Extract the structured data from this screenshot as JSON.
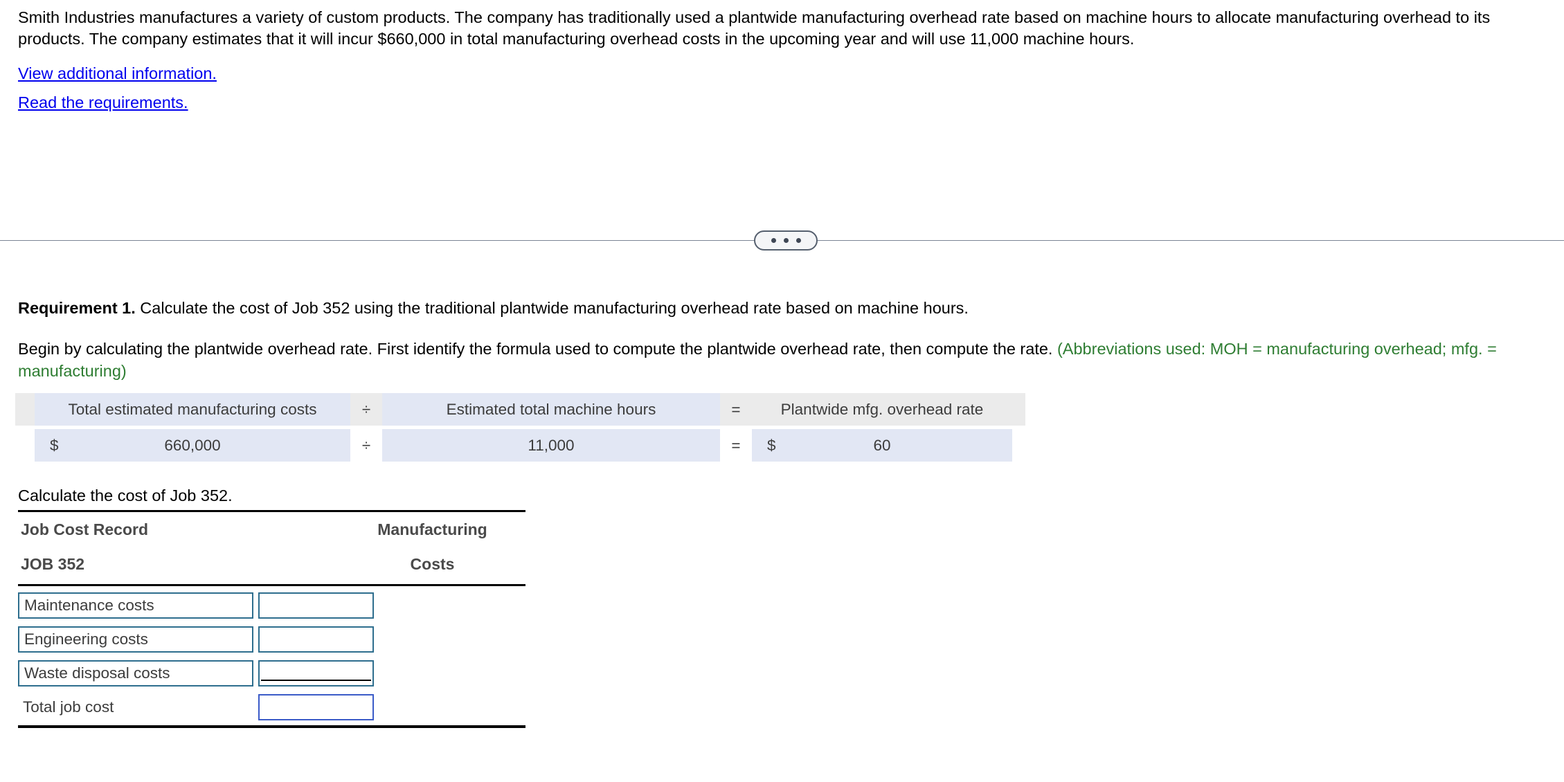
{
  "intro": {
    "paragraph": "Smith Industries manufactures a variety of custom products. The company has traditionally used a plantwide manufacturing overhead rate based on machine hours to allocate manufacturing overhead to its products. The company estimates that it will incur $660,000 in total manufacturing overhead costs in the upcoming year and will use 11,000 machine hours."
  },
  "links": {
    "view_additional": "View additional information.",
    "read_requirements": "Read the requirements."
  },
  "divider": {
    "expand_icon": "ellipsis-icon"
  },
  "requirement": {
    "label": "Requirement 1.",
    "text": " Calculate the cost of Job 352 using the traditional plantwide manufacturing overhead rate based on machine hours.",
    "begin_text": "Begin by calculating the plantwide overhead rate. First identify the formula used to compute the plantwide overhead rate, then compute the rate. ",
    "abbreviations": "(Abbreviations used: MOH = manufacturing overhead; mfg. = manufacturing)",
    "abbreviations_color": "#2e7d32"
  },
  "formula_table": {
    "headers": {
      "col1": "Total estimated manufacturing costs",
      "op1": "÷",
      "col2": "Estimated total machine hours",
      "op2": "=",
      "col3": "Plantwide mfg. overhead rate"
    },
    "values": {
      "col1_currency": "$",
      "col1_value": "660,000",
      "op1": "÷",
      "col2_value": "11,000",
      "op2": "=",
      "col3_currency": "$",
      "col3_value": "60"
    },
    "header_bg": "#ebebeb",
    "cell_bg": "#e2e7f4"
  },
  "calc_prompt": "Calculate the cost of Job 352.",
  "job_table": {
    "header_left_line1": "Job Cost Record",
    "header_left_line2": "JOB 352",
    "header_right_line1": "Manufacturing",
    "header_right_line2": "Costs",
    "rows": [
      {
        "label": "Maintenance costs",
        "value": "",
        "label_boxed": true,
        "value_boxed": true,
        "subrule": false,
        "focused": false
      },
      {
        "label": "Engineering costs",
        "value": "",
        "label_boxed": true,
        "value_boxed": true,
        "subrule": false,
        "focused": false
      },
      {
        "label": "Waste disposal costs",
        "value": "",
        "label_boxed": true,
        "value_boxed": true,
        "subrule": true,
        "focused": false
      },
      {
        "label": "Total job cost",
        "value": "",
        "label_boxed": false,
        "value_boxed": true,
        "subrule": false,
        "focused": true
      }
    ],
    "border_color": "#2e6e8e",
    "focus_border_color": "#3b5bc8"
  }
}
